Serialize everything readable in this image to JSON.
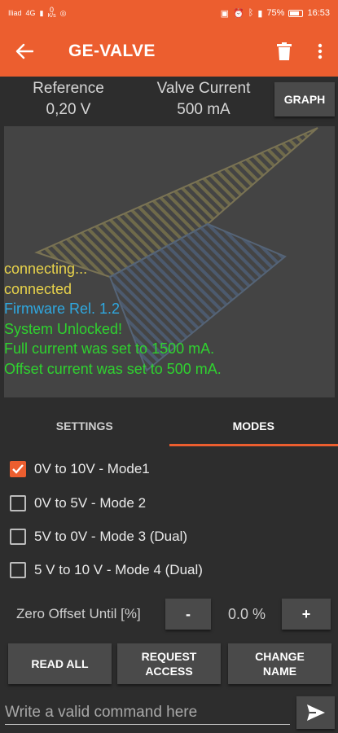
{
  "status_bar": {
    "carrier": "Iliad",
    "network": "4G",
    "speed_value": "0",
    "speed_unit": "K/s",
    "battery": "75%",
    "time": "16:53"
  },
  "app_bar": {
    "title": "GE-VALVE",
    "back_icon": "arrow-left-icon",
    "delete_icon": "trash-icon",
    "menu_icon": "more-vertical-icon"
  },
  "readouts": {
    "reference_label": "Reference",
    "reference_value": "0,20 V",
    "current_label": "Valve Current",
    "current_value": "500 mA",
    "graph_button": "GRAPH"
  },
  "log": [
    {
      "text": "connecting...",
      "color": "yellow"
    },
    {
      "text": "connected",
      "color": "yellow"
    },
    {
      "text": "Firmware Rel. 1.2",
      "color": "blue"
    },
    {
      "text": "System Unlocked!",
      "color": "green"
    },
    {
      "text": "Full current was set to 1500 mA.",
      "color": "green"
    },
    {
      "text": "Offset current was set to 500 mA.",
      "color": "green"
    }
  ],
  "tabs": [
    {
      "label": "SETTINGS",
      "active": false
    },
    {
      "label": "MODES",
      "active": true
    }
  ],
  "modes": [
    {
      "label": "0V to 10V - Mode1",
      "checked": true
    },
    {
      "label": "0V to 5V - Mode 2",
      "checked": false
    },
    {
      "label": "5V to 0V - Mode 3 (Dual)",
      "checked": false
    },
    {
      "label": "5 V to 10 V - Mode 4 (Dual)",
      "checked": false
    }
  ],
  "zero_offset": {
    "label": "Zero Offset Until [%]",
    "minus": "-",
    "value": "0.0 %",
    "plus": "+"
  },
  "actions": {
    "read_all": "READ ALL",
    "request_access": "REQUEST\nACCESS",
    "change_name": "CHANGE\nNAME"
  },
  "command": {
    "placeholder": "Write a valid command here",
    "send_icon": "send-icon"
  },
  "colors": {
    "accent": "#ec5e2f",
    "log_yellow": "#e8d34b",
    "log_blue": "#2fa8e0",
    "log_green": "#2fd22f"
  }
}
